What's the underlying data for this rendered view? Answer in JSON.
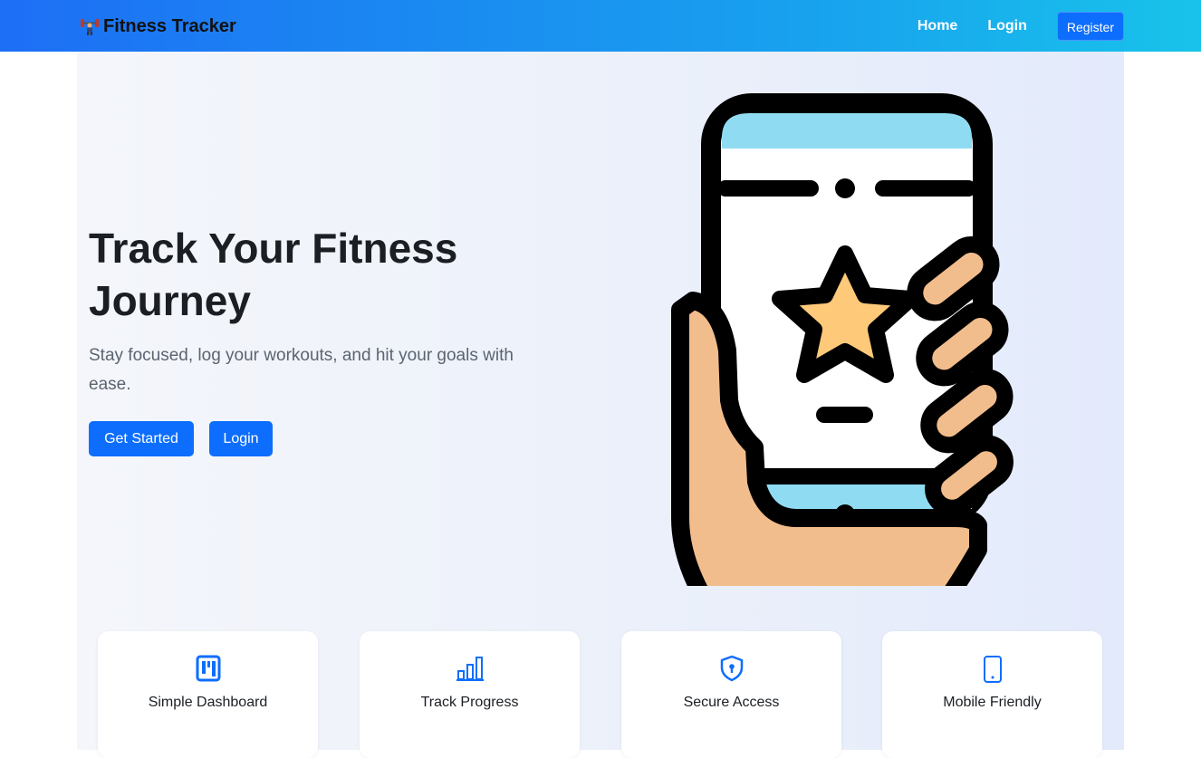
{
  "navbar": {
    "brand": "Fitness Tracker",
    "brand_icon": "weightlifter-icon",
    "links": [
      "Home",
      "Login"
    ],
    "register_label": "Register"
  },
  "hero": {
    "title": "Track Your Fitness Journey",
    "subtitle": "Stay focused, log your workouts, and hit your goals with ease.",
    "get_started_label": "Get Started",
    "login_label": "Login",
    "illustration": "hand-holding-phone-star-icon"
  },
  "features": [
    {
      "label": "Simple Dashboard",
      "icon": "dashboard-icon"
    },
    {
      "label": "Track Progress",
      "icon": "bar-chart-icon"
    },
    {
      "label": "Secure Access",
      "icon": "shield-lock-icon"
    },
    {
      "label": "Mobile Friendly",
      "icon": "phone-icon"
    }
  ],
  "colors": {
    "primary": "#0d6efd",
    "navbar_start": "#1d6ff5",
    "navbar_end": "#18c3ea",
    "heading": "#1b1f24",
    "muted": "#5b6470"
  }
}
